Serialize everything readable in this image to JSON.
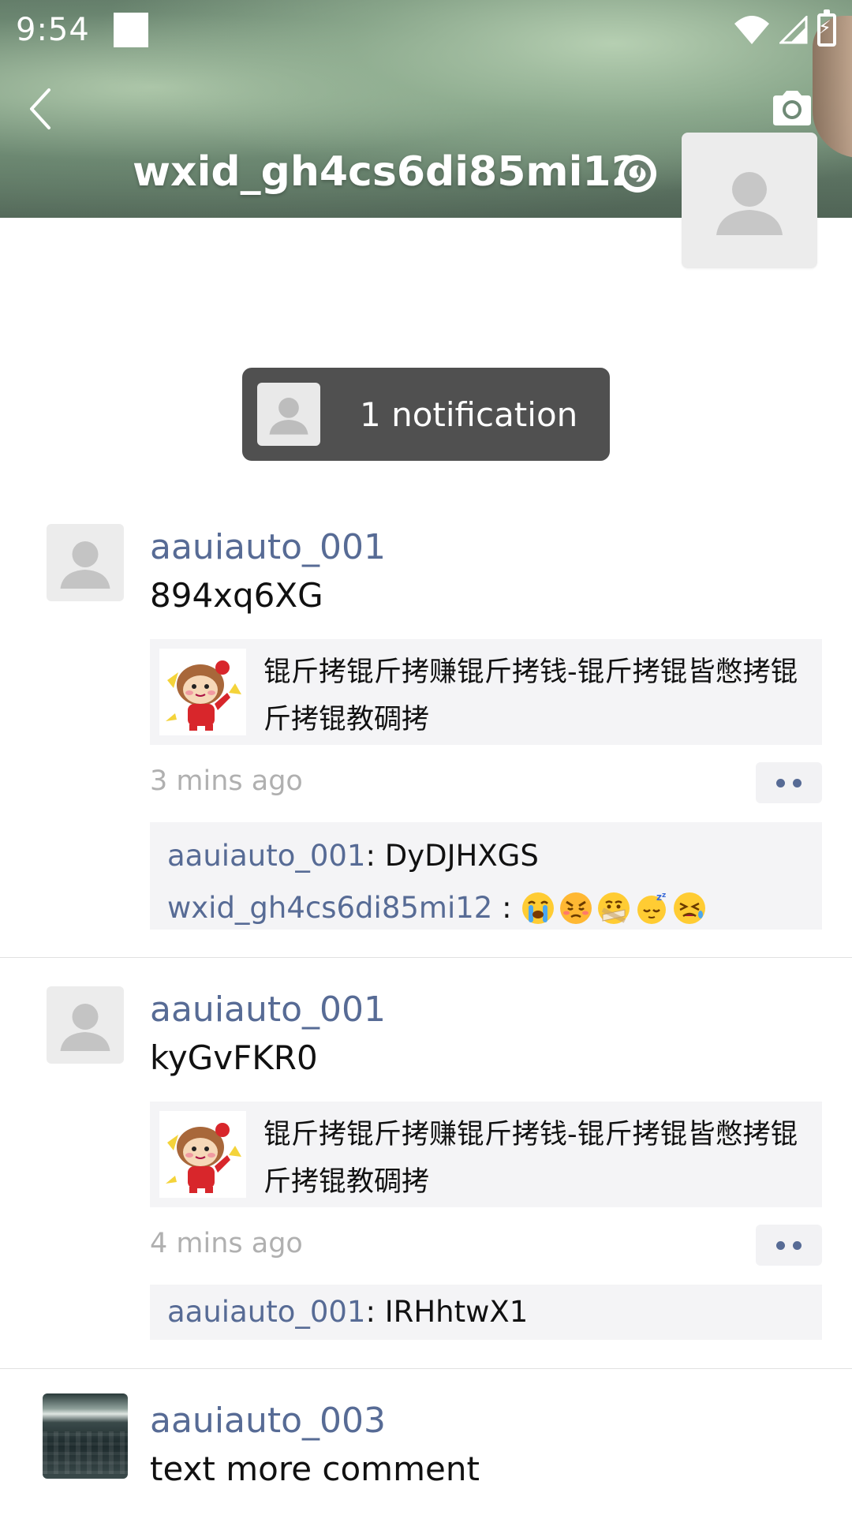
{
  "status_bar": {
    "time": "9:54"
  },
  "header": {
    "profile_name": "wxid_gh4cs6di85mi12"
  },
  "notification": {
    "label": "1 notification"
  },
  "posts": [
    {
      "user": "aauiauto_001",
      "text": "894xq6XG",
      "share_title": "锟斤拷锟斤拷赚锟斤拷钱-锟斤拷锟皆憋拷锟斤拷锟教碉拷",
      "time": "3 mins ago",
      "comments": [
        {
          "name": "aauiauto_001",
          "sep": ": ",
          "body": "DyDJHXGS"
        },
        {
          "name": "wxid_gh4cs6di85mi12",
          "sep": " : ",
          "body": "",
          "emojis": [
            "crying-emoji",
            "angry-emoji",
            "shush-emoji",
            "sleepy-emoji",
            "frustrated-emoji"
          ]
        }
      ]
    },
    {
      "user": "aauiauto_001",
      "text": "kyGvFKR0",
      "share_title": "锟斤拷锟斤拷赚锟斤拷钱-锟斤拷锟皆憋拷锟斤拷锟教碉拷",
      "time": "4 mins ago",
      "comments": [
        {
          "name": "aauiauto_001",
          "sep": ": ",
          "body": "IRHhtwX1"
        }
      ]
    },
    {
      "user": "aauiauto_003",
      "text": "text more comment"
    }
  ],
  "colors": {
    "link": "#576b95",
    "notification_bg": "#505050",
    "card_bg": "#f4f4f6",
    "time_text": "#b0b0b0"
  }
}
